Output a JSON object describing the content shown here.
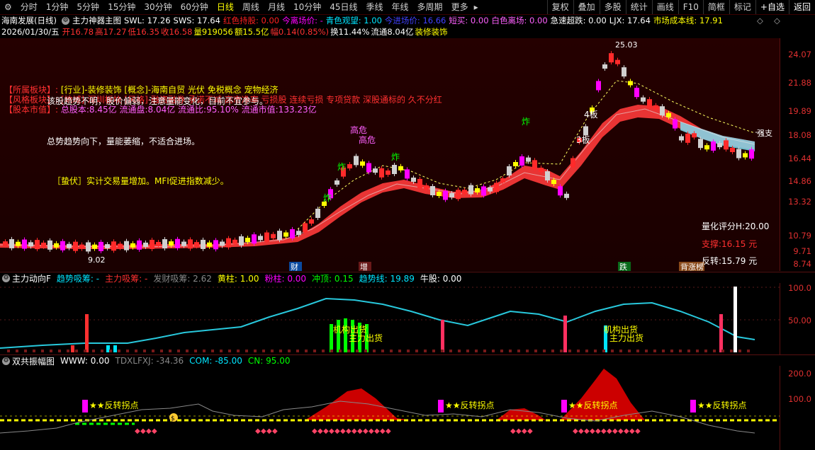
{
  "topbar": {
    "gear": "⚙",
    "periods": [
      "分时",
      "1分钟",
      "5分钟",
      "15分钟",
      "30分钟",
      "60分钟",
      "日线",
      "周线",
      "月线",
      "10分钟",
      "45日线",
      "季线",
      "年线",
      "多周期",
      "更多"
    ],
    "active_period": "日线",
    "right_buttons": [
      "复权",
      "叠加",
      "多股",
      "统计",
      "画线",
      "F10",
      "简框",
      "标记",
      "+自选",
      "返回"
    ]
  },
  "header": {
    "stock_name": "海南发展(日线)",
    "indicator_main": "主力神器主图",
    "swl": "SWL: 17.26",
    "sws": "SWS: 17.64",
    "hong_se": "红色持股: 0.00",
    "jin_li": "今离场价: -",
    "qing_se": "青色观望: 1.00",
    "jin_jin": "今进场价: 16.66",
    "duan_mai": "短买: 0.00",
    "bai_se": "白色离场: 0.00",
    "ji_su": "急速超跌: 0.00",
    "ljx": "LJX: 17.64",
    "chengben": "市场成本线: 17.91"
  },
  "quote": {
    "date": "2026/01/30/五",
    "open": "开16.78",
    "high": "高17.27",
    "low": "低16.35",
    "close": "收16.58",
    "vol": "量919056",
    "amount": "额15.5亿",
    "amp": "幅0.14(0.85%)",
    "turnover": "换11.44%",
    "float": "流通8.04亿",
    "sector": "装修装饰"
  },
  "info": {
    "l1_label": "【所属板块】:",
    "l1_text": "[行业]-装修装饰 [概念]-海南自贸 光伏 免税概念 宠物经济",
    "l2_label": "【风格板块】:",
    "l2_text": "[地域]-深圳板块 [风格]-融资融券 承诺不减 高市净率 亏损股 连续亏损 专项贷款 深股通标的 久不分红",
    "l3_label": "【股本市值】:",
    "l3_text": "总股本:8.45亿 流通盘:8.04亿 流通比:95.10% 流通市值:133.23亿"
  },
  "notes": {
    "n1": "该股趋势不明，股价偏弱，注意量能变化，目前不宜参与。",
    "n2": "总势趋势向下，量能萎缩，不适合进场。",
    "n3": "［蛰伏］实计交易量增加。MFI促进指数减少。"
  },
  "score": {
    "rating": "量化评分H:20.00",
    "support": "支撑:16.15 元",
    "reversal": "反转:15.79 元"
  },
  "chart_labels": {
    "peak": "25.03",
    "low": "9.02",
    "gaowei1": "高危",
    "gaowei2": "高危",
    "zha1": "炸",
    "zha2": "炸",
    "zha3": "炸",
    "zha4": "炸",
    "ban4": "4板",
    "ban3": "3板",
    "qiangzhi": "强支",
    "b_cai": "财",
    "b_zeng": "增",
    "b_die": "跌",
    "b_bei": "背涨榜"
  },
  "yaxis_main": [
    "24.07",
    "21.88",
    "19.89",
    "18.08",
    "16.44",
    "14.86",
    "13.32",
    "10.79",
    "9.71",
    "8.74"
  ],
  "panel1": {
    "title": "主力动向F",
    "qushi": "趋势吸筹: -",
    "zhuli": "主力吸筹: -",
    "fa_cai": "发财吸筹: 2.62",
    "huang": "黄柱: 1.00",
    "fen": "粉柱: 0.00",
    "chong": "冲顶: 0.15",
    "qushi_line": "趋势线: 19.89",
    "niu": "牛股: 0.00",
    "y": [
      "100.0",
      "50.00"
    ],
    "lbl_jigou": "机构出货",
    "lbl_zhuli": "主力出货",
    "lbl_jigou2": "机构出货",
    "lbl_zhuli2": "主力出货"
  },
  "panel2": {
    "title": "双共振幅图",
    "www": "WWW: 0.00",
    "tdx": "TDXLFXJ: -34.36",
    "com": "COM: -85.00",
    "cn": "CN: 95.00",
    "y": [
      "200.0",
      "100.0"
    ],
    "flag": "★★反转拐点"
  },
  "colors": {
    "up": "#ff3333",
    "down": "#00ffff",
    "yellow": "#ffff00",
    "magenta": "#ff00ff",
    "green": "#00ff00",
    "cyan": "#28c8dc"
  }
}
